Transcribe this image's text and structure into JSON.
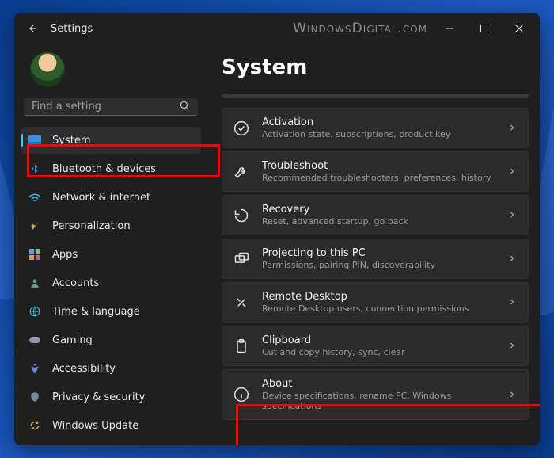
{
  "titlebar": {
    "title": "Settings"
  },
  "watermark": "WindowsDigital.com",
  "search": {
    "placeholder": "Find a setting"
  },
  "sidebar": {
    "items": [
      {
        "label": "System",
        "icon": "system-icon",
        "active": true
      },
      {
        "label": "Bluetooth & devices",
        "icon": "bluetooth-icon"
      },
      {
        "label": "Network & internet",
        "icon": "wifi-icon"
      },
      {
        "label": "Personalization",
        "icon": "brush-icon"
      },
      {
        "label": "Apps",
        "icon": "apps-icon"
      },
      {
        "label": "Accounts",
        "icon": "person-icon"
      },
      {
        "label": "Time & language",
        "icon": "globe-icon"
      },
      {
        "label": "Gaming",
        "icon": "gamepad-icon"
      },
      {
        "label": "Accessibility",
        "icon": "accessibility-icon"
      },
      {
        "label": "Privacy & security",
        "icon": "shield-icon"
      },
      {
        "label": "Windows Update",
        "icon": "update-icon"
      }
    ]
  },
  "main": {
    "title": "System",
    "items": [
      {
        "title": "Activation",
        "sub": "Activation state, subscriptions, product key",
        "icon": "check-circle-icon"
      },
      {
        "title": "Troubleshoot",
        "sub": "Recommended troubleshooters, preferences, history",
        "icon": "wrench-icon"
      },
      {
        "title": "Recovery",
        "sub": "Reset, advanced startup, go back",
        "icon": "recovery-icon"
      },
      {
        "title": "Projecting to this PC",
        "sub": "Permissions, pairing PIN, discoverability",
        "icon": "project-icon"
      },
      {
        "title": "Remote Desktop",
        "sub": "Remote Desktop users, connection permissions",
        "icon": "remote-icon"
      },
      {
        "title": "Clipboard",
        "sub": "Cut and copy history, sync, clear",
        "icon": "clipboard-icon"
      },
      {
        "title": "About",
        "sub": "Device specifications, rename PC, Windows specifications",
        "icon": "info-icon"
      }
    ]
  }
}
